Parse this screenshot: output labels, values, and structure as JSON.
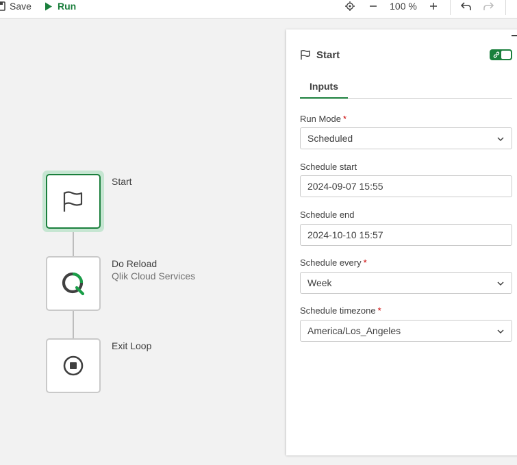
{
  "toolbar": {
    "save_label": "Save",
    "run_label": "Run",
    "zoom_label": "100 %"
  },
  "canvas": {
    "nodes": [
      {
        "title": "Start",
        "subtitle": "",
        "icon": "flag-icon"
      },
      {
        "title": "Do Reload",
        "subtitle": "Qlik Cloud Services",
        "icon": "qlik-logo-icon"
      },
      {
        "title": "Exit Loop",
        "subtitle": "",
        "icon": "stop-circle-icon"
      }
    ]
  },
  "panel": {
    "title": "Start",
    "tabs": [
      {
        "label": "Inputs"
      }
    ],
    "fields": [
      {
        "label": "Run Mode",
        "required": "*",
        "value": "Scheduled",
        "type": "select"
      },
      {
        "label": "Schedule start",
        "required": "",
        "value": "2024-09-07 15:55",
        "type": "text"
      },
      {
        "label": "Schedule end",
        "required": "",
        "value": "2024-10-10 15:57",
        "type": "text"
      },
      {
        "label": "Schedule every",
        "required": "*",
        "value": "Week",
        "type": "select"
      },
      {
        "label": "Schedule timezone",
        "required": "*",
        "value": "America/Los_Angeles",
        "type": "select"
      }
    ]
  },
  "colors": {
    "accent": "#1a7f3c",
    "selected_halo": "#c6e6d2",
    "required": "#cc0000",
    "canvas_bg": "#f2f2f2"
  }
}
